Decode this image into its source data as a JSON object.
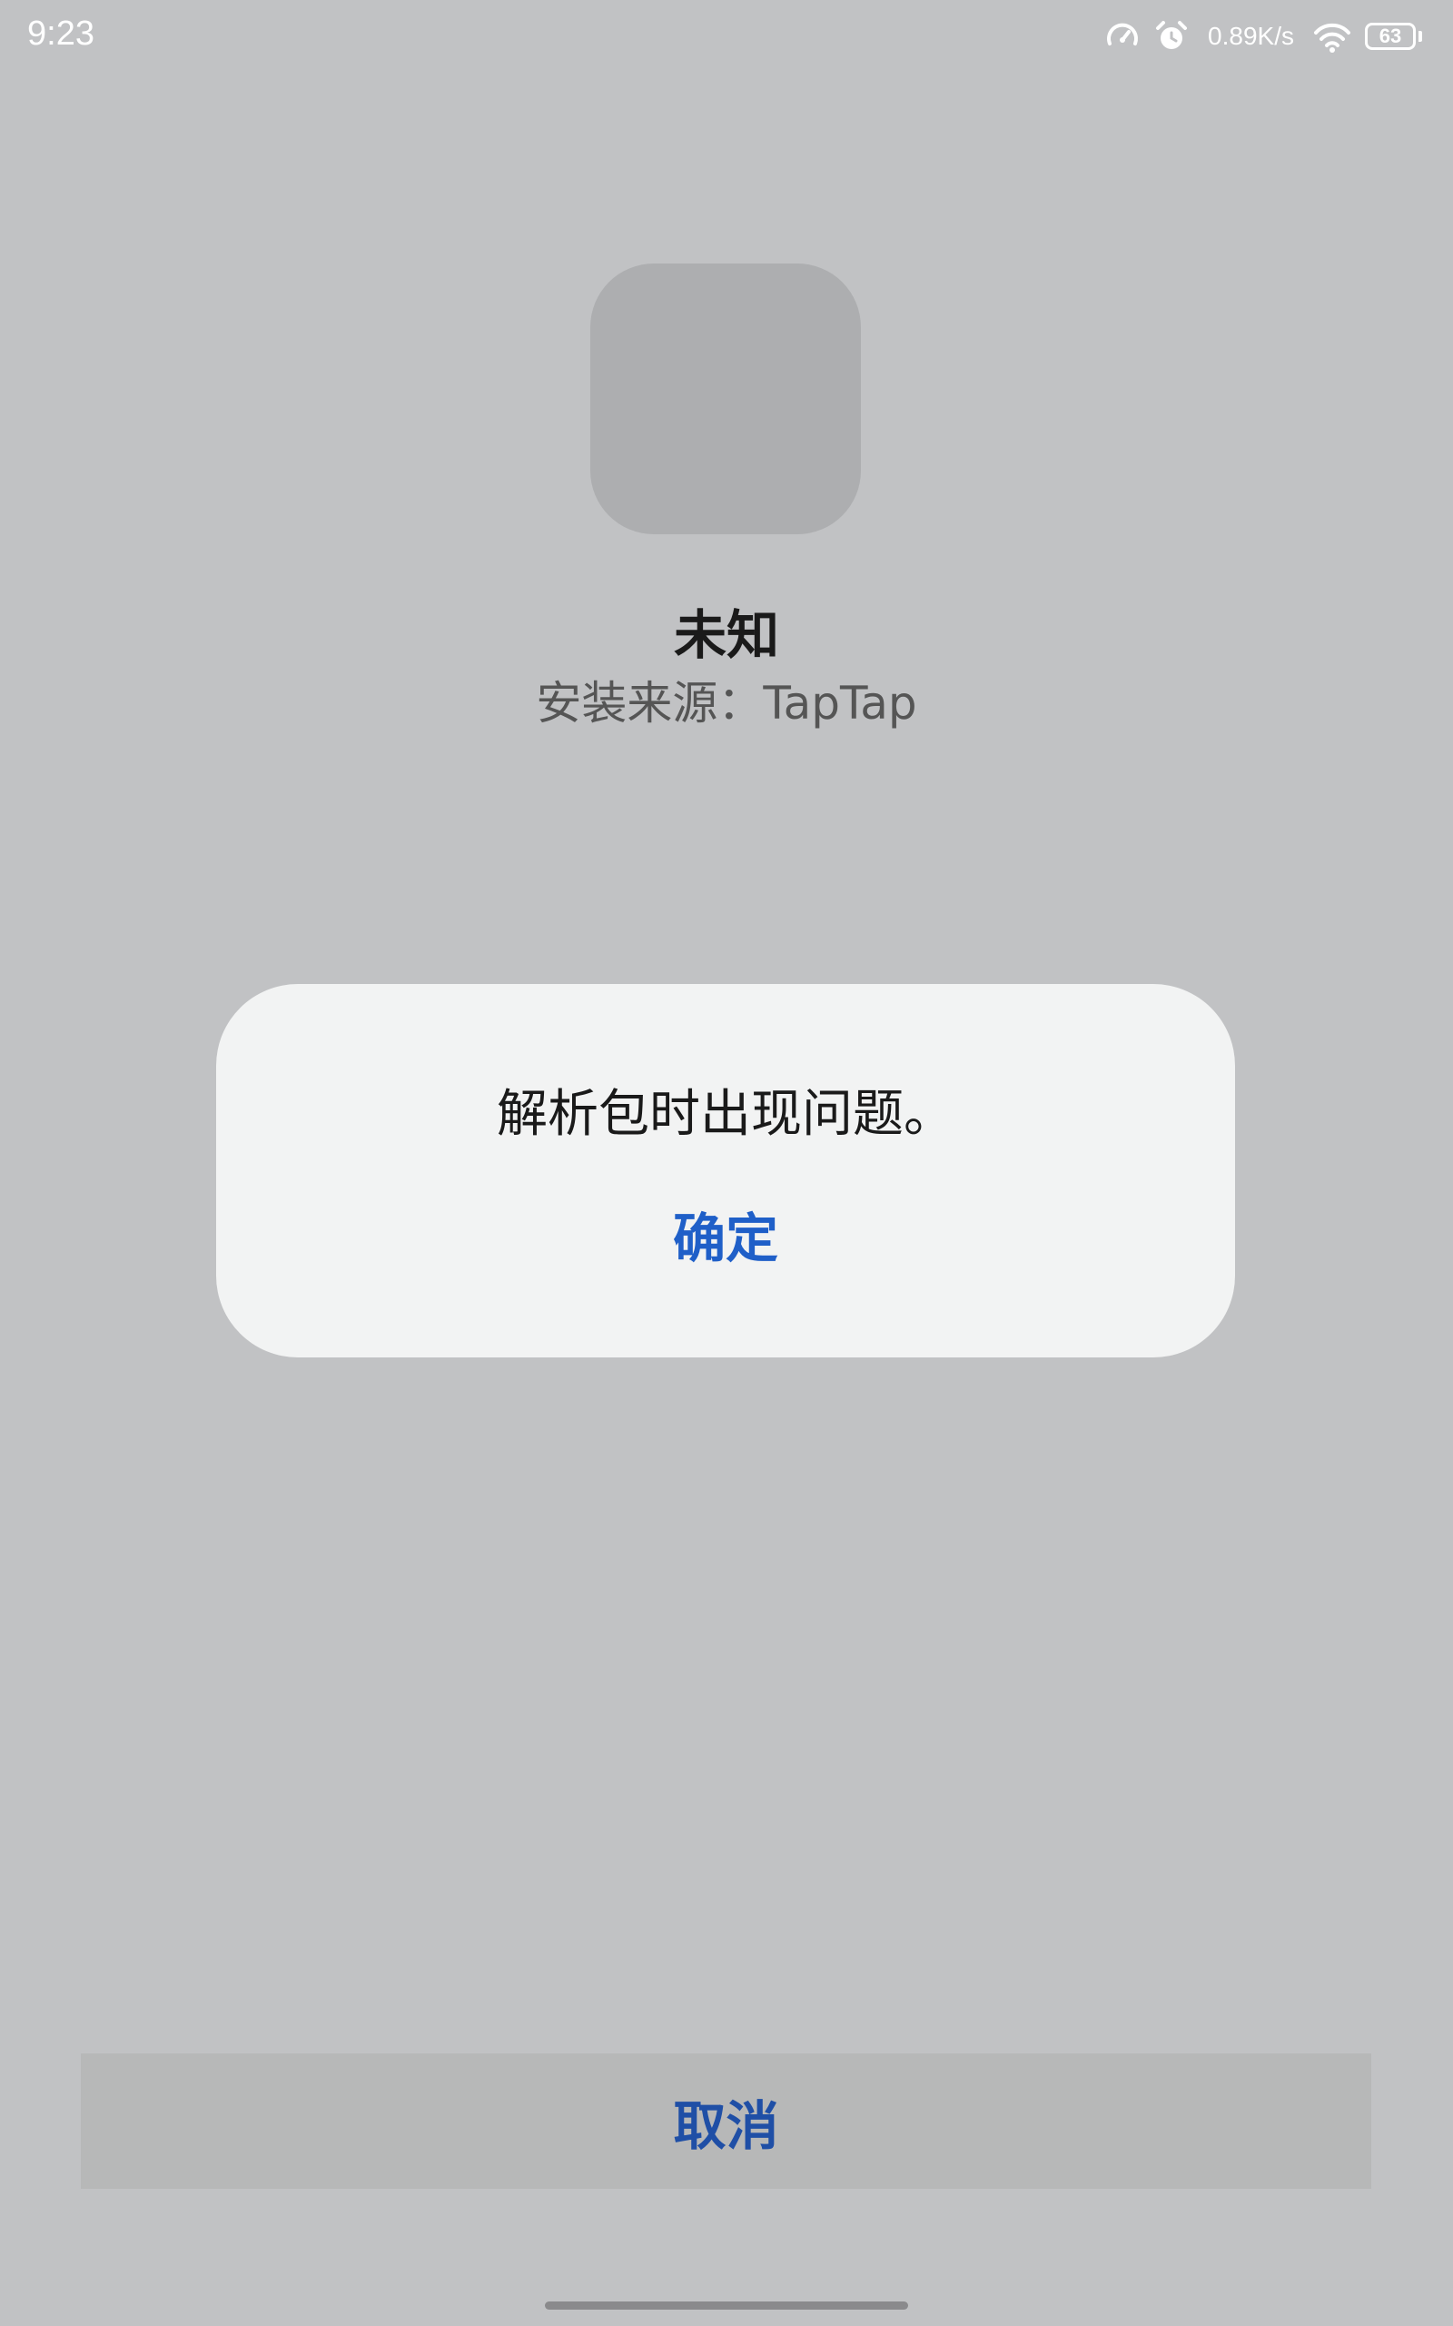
{
  "status_bar": {
    "time": "9:23",
    "net_speed": "0.89K/s",
    "battery_level": "63",
    "icons": [
      "speedometer-icon",
      "alarm-icon",
      "wifi-icon",
      "battery-icon"
    ]
  },
  "app": {
    "name": "未知",
    "source": "安装来源：TapTap"
  },
  "dialog": {
    "message": "解析包时出现问题。",
    "confirm_label": "确定"
  },
  "footer": {
    "cancel_label": "取消"
  },
  "colors": {
    "background": "#c1c2c4",
    "dialog_bg": "#f2f3f3",
    "accent": "#1f5fc8"
  }
}
